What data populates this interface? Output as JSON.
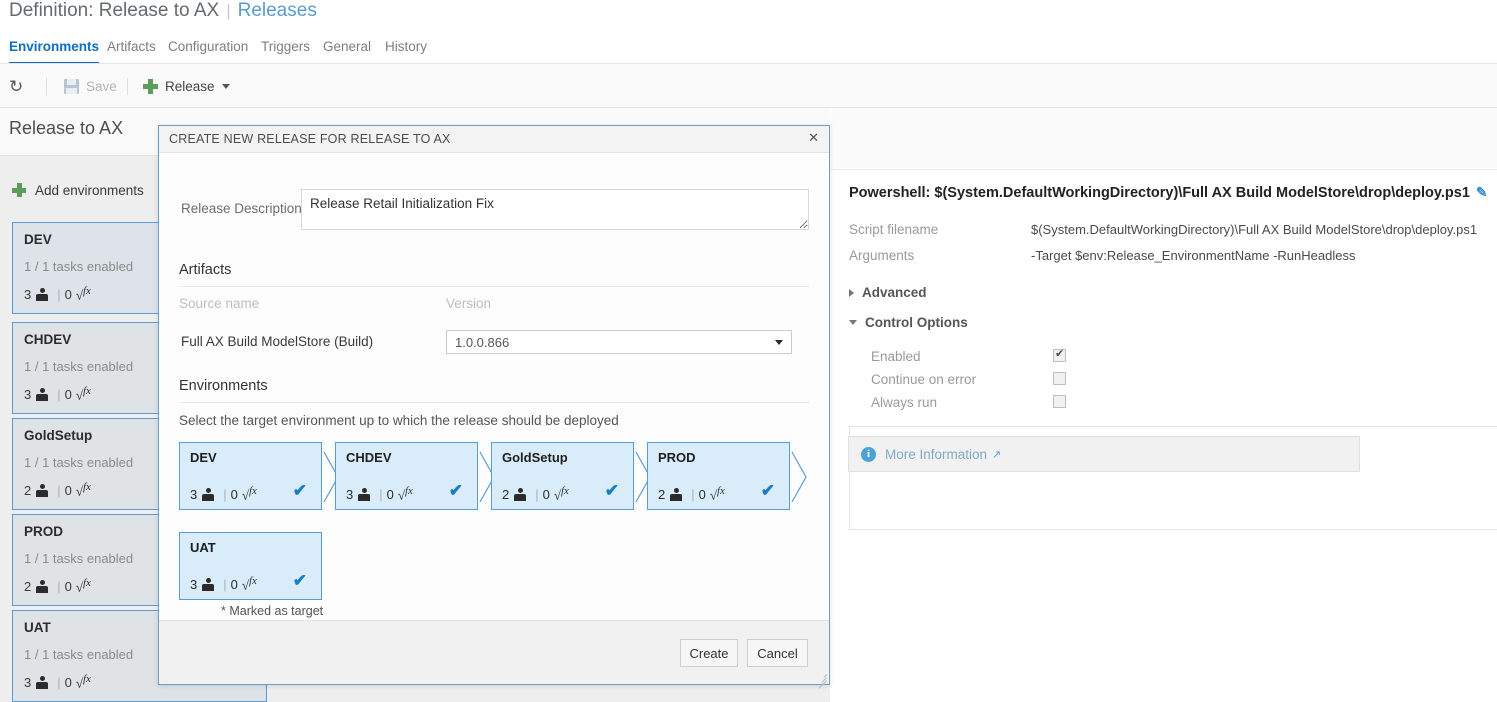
{
  "header": {
    "definition_prefix": "Definition: Release to AX",
    "separator": "|",
    "breadcrumb_link": "Releases"
  },
  "tabs": [
    {
      "label": "Environments",
      "active": true
    },
    {
      "label": "Artifacts",
      "active": false
    },
    {
      "label": "Configuration",
      "active": false
    },
    {
      "label": "Triggers",
      "active": false
    },
    {
      "label": "General",
      "active": false
    },
    {
      "label": "History",
      "active": false
    }
  ],
  "toolbar": {
    "refresh_icon": "refresh-icon",
    "save_label": "Save",
    "save_icon": "floppy-disk-icon",
    "release_label": "Release",
    "release_icon": "plus-icon",
    "release_caret": "chevron-down-icon"
  },
  "left_panel": {
    "definition_name": "Release to AX",
    "add_environments_label": "Add environments",
    "environments": [
      {
        "name": "DEV",
        "tasks": "1 / 1 tasks enabled",
        "approvers": "3",
        "variables": "0",
        "selected": true
      },
      {
        "name": "CHDEV",
        "tasks": "1 / 1 tasks enabled",
        "approvers": "3",
        "variables": "0",
        "selected": false
      },
      {
        "name": "GoldSetup",
        "tasks": "1 / 1 tasks enabled",
        "approvers": "2",
        "variables": "0",
        "selected": false
      },
      {
        "name": "PROD",
        "tasks": "1 / 1 tasks enabled",
        "approvers": "2",
        "variables": "0",
        "selected": false
      },
      {
        "name": "UAT",
        "tasks": "1 / 1 tasks enabled",
        "approvers": "3",
        "variables": "0",
        "selected": false
      }
    ]
  },
  "right_panel": {
    "title": "Powershell: $(System.DefaultWorkingDirectory)\\Full AX Build ModelStore\\drop\\deploy.ps1",
    "edit_icon": "pencil-icon",
    "fields": [
      {
        "label": "Script filename",
        "value": "$(System.DefaultWorkingDirectory)\\Full AX Build ModelStore\\drop\\deploy.ps1"
      },
      {
        "label": "Arguments",
        "value": "-Target $env:Release_EnvironmentName -RunHeadless"
      }
    ],
    "advanced_label": "Advanced",
    "control_options_label": "Control Options",
    "control_options": [
      {
        "label": "Enabled",
        "checked": true
      },
      {
        "label": "Continue on error",
        "checked": false
      },
      {
        "label": "Always run",
        "checked": false
      }
    ],
    "more_information_label": "More Information",
    "info_icon": "info-icon",
    "external_link_icon": "external-link-icon"
  },
  "modal": {
    "title": "CREATE NEW RELEASE FOR RELEASE TO AX",
    "close_icon": "close-icon",
    "description_label": "Release Description",
    "description_value": "Release Retail Initialization Fix",
    "description_placeholder": "",
    "artifacts_heading": "Artifacts",
    "col_source_name": "Source name",
    "col_version": "Version",
    "artifact_row": {
      "source_name": "Full AX Build ModelStore (Build)",
      "version_selected": "1.0.0.866",
      "version_options": [
        "1.0.0.866"
      ]
    },
    "environments_heading": "Environments",
    "environments_hint": "Select the target environment up to which the release should be deployed",
    "env_cards": [
      {
        "name": "DEV",
        "approvers": "3",
        "variables": "0",
        "checked": true
      },
      {
        "name": "CHDEV",
        "approvers": "3",
        "variables": "0",
        "checked": true
      },
      {
        "name": "GoldSetup",
        "approvers": "2",
        "variables": "0",
        "checked": true
      },
      {
        "name": "PROD",
        "approvers": "2",
        "variables": "0",
        "checked": true
      },
      {
        "name": "UAT",
        "approvers": "3",
        "variables": "0",
        "checked": true
      }
    ],
    "marked_as_target": "* Marked as target",
    "create_label": "Create",
    "cancel_label": "Cancel"
  },
  "colors": {
    "accent_blue": "#106ebe",
    "link_blue": "#5c9bd1",
    "card_border": "#5b9bd5",
    "dialog_card_fill": "#d9ecfa",
    "check_blue": "#1a7fc1",
    "plus_green": "#5a9e5a"
  }
}
